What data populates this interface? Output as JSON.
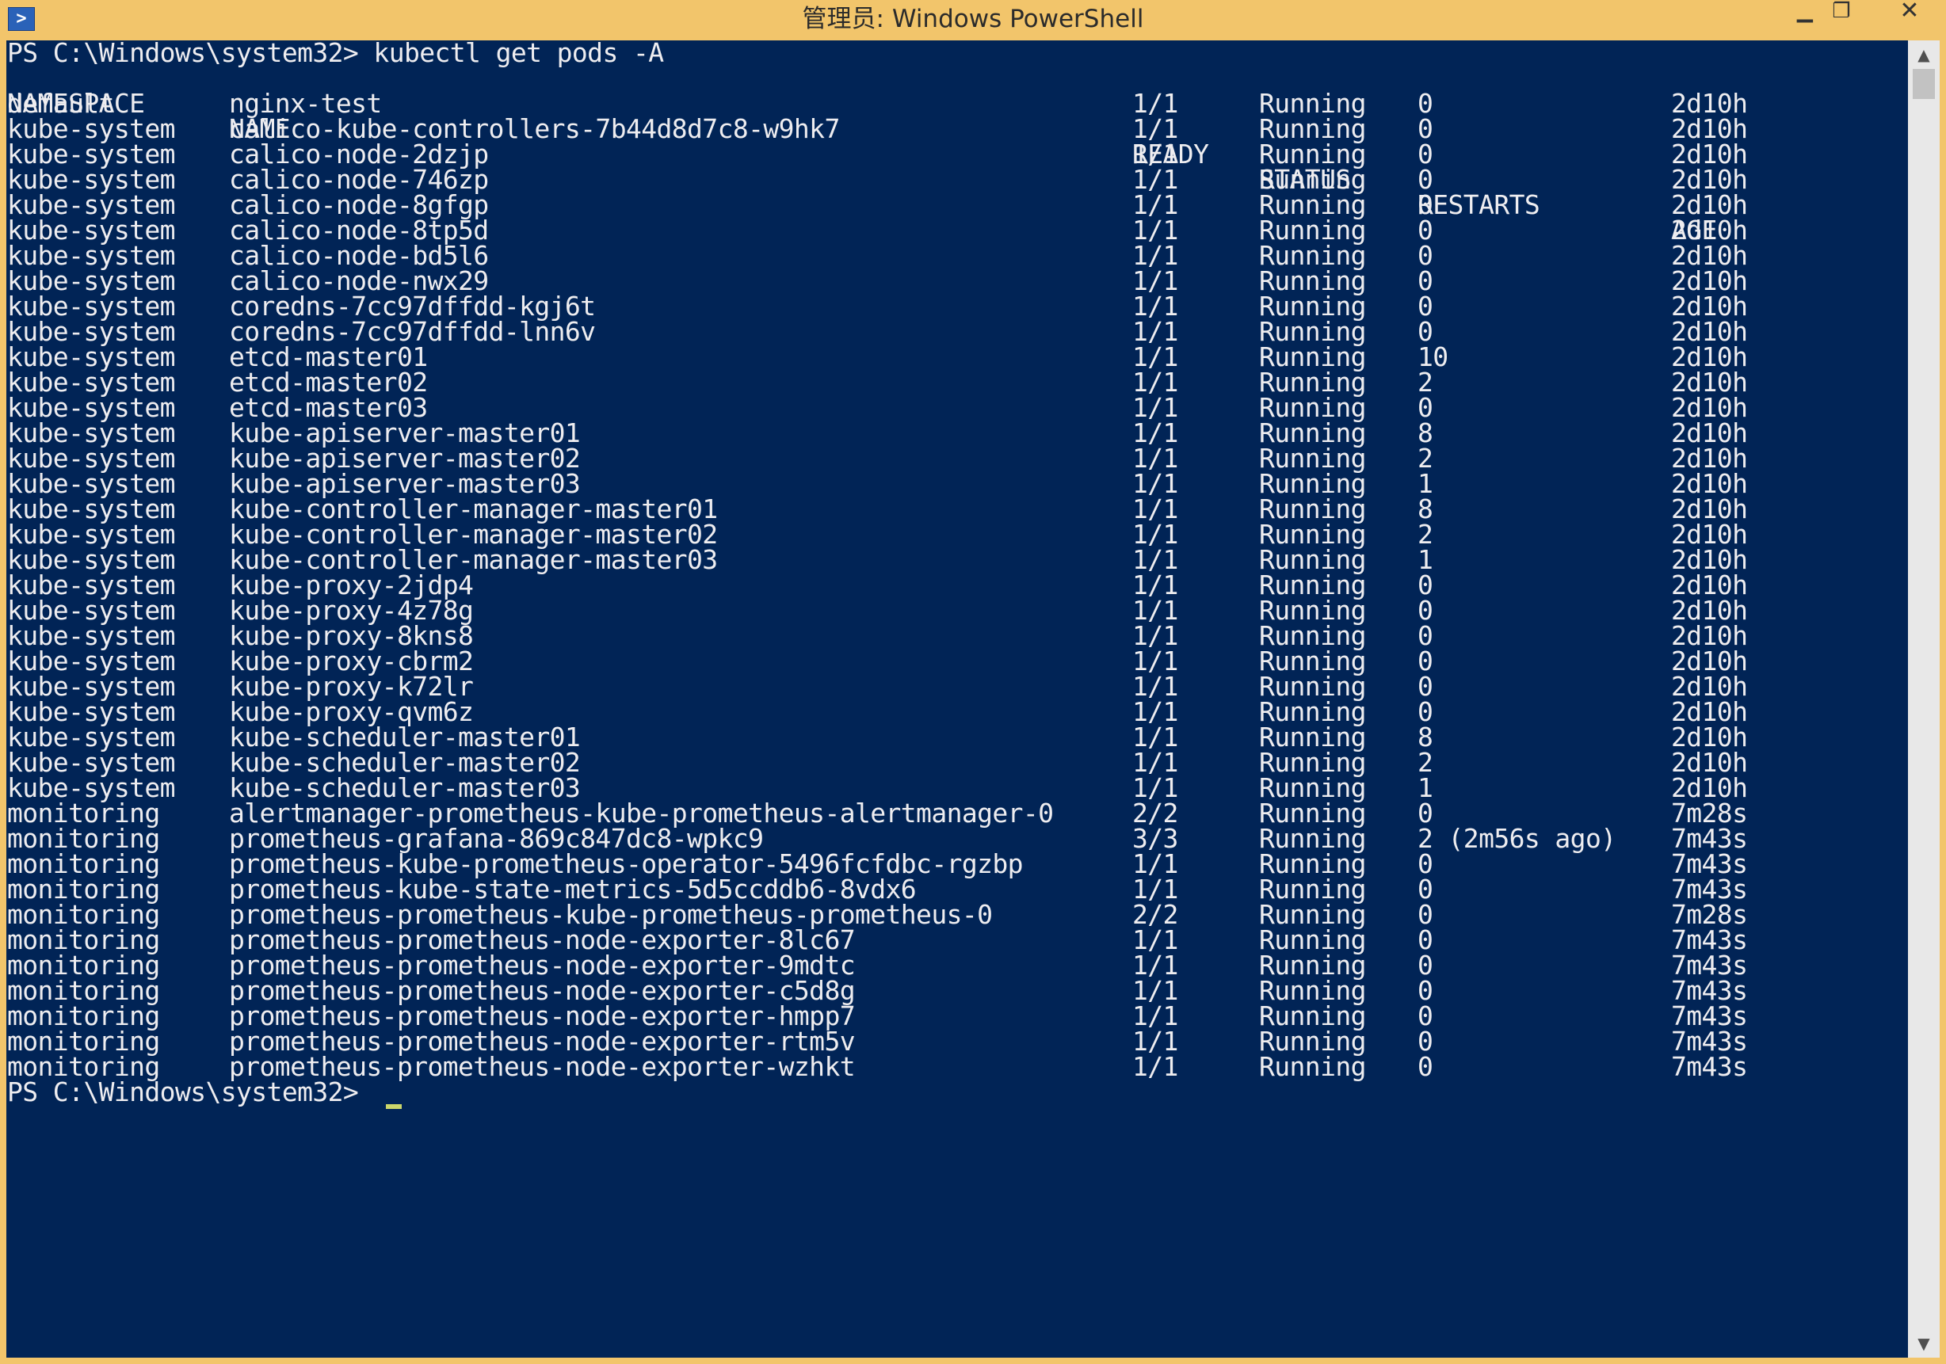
{
  "window": {
    "title": "管理员: Windows PowerShell",
    "icon": "powershell-icon",
    "controls": {
      "minimize": "▁",
      "maximize": "❐",
      "close": "✕"
    }
  },
  "console": {
    "prompt_command": "PS C:\\Windows\\system32> kubectl get pods -A",
    "prompt_end": "PS C:\\Windows\\system32> ",
    "headers": {
      "namespace": "NAMESPACE",
      "name": "NAME",
      "ready": "READY",
      "status": "STATUS",
      "restarts": "RESTARTS",
      "age": "AGE"
    },
    "rows": [
      {
        "ns": "default",
        "name": "nginx-test",
        "ready": "1/1",
        "status": "Running",
        "restarts": "0",
        "age": "2d10h"
      },
      {
        "ns": "kube-system",
        "name": "calico-kube-controllers-7b44d8d7c8-w9hk7",
        "ready": "1/1",
        "status": "Running",
        "restarts": "0",
        "age": "2d10h"
      },
      {
        "ns": "kube-system",
        "name": "calico-node-2dzjp",
        "ready": "1/1",
        "status": "Running",
        "restarts": "0",
        "age": "2d10h"
      },
      {
        "ns": "kube-system",
        "name": "calico-node-746zp",
        "ready": "1/1",
        "status": "Running",
        "restarts": "0",
        "age": "2d10h"
      },
      {
        "ns": "kube-system",
        "name": "calico-node-8gfgp",
        "ready": "1/1",
        "status": "Running",
        "restarts": "0",
        "age": "2d10h"
      },
      {
        "ns": "kube-system",
        "name": "calico-node-8tp5d",
        "ready": "1/1",
        "status": "Running",
        "restarts": "0",
        "age": "2d10h"
      },
      {
        "ns": "kube-system",
        "name": "calico-node-bd5l6",
        "ready": "1/1",
        "status": "Running",
        "restarts": "0",
        "age": "2d10h"
      },
      {
        "ns": "kube-system",
        "name": "calico-node-nwx29",
        "ready": "1/1",
        "status": "Running",
        "restarts": "0",
        "age": "2d10h"
      },
      {
        "ns": "kube-system",
        "name": "coredns-7cc97dffdd-kgj6t",
        "ready": "1/1",
        "status": "Running",
        "restarts": "0",
        "age": "2d10h"
      },
      {
        "ns": "kube-system",
        "name": "coredns-7cc97dffdd-lnn6v",
        "ready": "1/1",
        "status": "Running",
        "restarts": "0",
        "age": "2d10h"
      },
      {
        "ns": "kube-system",
        "name": "etcd-master01",
        "ready": "1/1",
        "status": "Running",
        "restarts": "10",
        "age": "2d10h"
      },
      {
        "ns": "kube-system",
        "name": "etcd-master02",
        "ready": "1/1",
        "status": "Running",
        "restarts": "2",
        "age": "2d10h"
      },
      {
        "ns": "kube-system",
        "name": "etcd-master03",
        "ready": "1/1",
        "status": "Running",
        "restarts": "0",
        "age": "2d10h"
      },
      {
        "ns": "kube-system",
        "name": "kube-apiserver-master01",
        "ready": "1/1",
        "status": "Running",
        "restarts": "8",
        "age": "2d10h"
      },
      {
        "ns": "kube-system",
        "name": "kube-apiserver-master02",
        "ready": "1/1",
        "status": "Running",
        "restarts": "2",
        "age": "2d10h"
      },
      {
        "ns": "kube-system",
        "name": "kube-apiserver-master03",
        "ready": "1/1",
        "status": "Running",
        "restarts": "1",
        "age": "2d10h"
      },
      {
        "ns": "kube-system",
        "name": "kube-controller-manager-master01",
        "ready": "1/1",
        "status": "Running",
        "restarts": "8",
        "age": "2d10h"
      },
      {
        "ns": "kube-system",
        "name": "kube-controller-manager-master02",
        "ready": "1/1",
        "status": "Running",
        "restarts": "2",
        "age": "2d10h"
      },
      {
        "ns": "kube-system",
        "name": "kube-controller-manager-master03",
        "ready": "1/1",
        "status": "Running",
        "restarts": "1",
        "age": "2d10h"
      },
      {
        "ns": "kube-system",
        "name": "kube-proxy-2jdp4",
        "ready": "1/1",
        "status": "Running",
        "restarts": "0",
        "age": "2d10h"
      },
      {
        "ns": "kube-system",
        "name": "kube-proxy-4z78g",
        "ready": "1/1",
        "status": "Running",
        "restarts": "0",
        "age": "2d10h"
      },
      {
        "ns": "kube-system",
        "name": "kube-proxy-8kns8",
        "ready": "1/1",
        "status": "Running",
        "restarts": "0",
        "age": "2d10h"
      },
      {
        "ns": "kube-system",
        "name": "kube-proxy-cbrm2",
        "ready": "1/1",
        "status": "Running",
        "restarts": "0",
        "age": "2d10h"
      },
      {
        "ns": "kube-system",
        "name": "kube-proxy-k72lr",
        "ready": "1/1",
        "status": "Running",
        "restarts": "0",
        "age": "2d10h"
      },
      {
        "ns": "kube-system",
        "name": "kube-proxy-qvm6z",
        "ready": "1/1",
        "status": "Running",
        "restarts": "0",
        "age": "2d10h"
      },
      {
        "ns": "kube-system",
        "name": "kube-scheduler-master01",
        "ready": "1/1",
        "status": "Running",
        "restarts": "8",
        "age": "2d10h"
      },
      {
        "ns": "kube-system",
        "name": "kube-scheduler-master02",
        "ready": "1/1",
        "status": "Running",
        "restarts": "2",
        "age": "2d10h"
      },
      {
        "ns": "kube-system",
        "name": "kube-scheduler-master03",
        "ready": "1/1",
        "status": "Running",
        "restarts": "1",
        "age": "2d10h"
      },
      {
        "ns": "monitoring",
        "name": "alertmanager-prometheus-kube-prometheus-alertmanager-0",
        "ready": "2/2",
        "status": "Running",
        "restarts": "0",
        "age": "7m28s"
      },
      {
        "ns": "monitoring",
        "name": "prometheus-grafana-869c847dc8-wpkc9",
        "ready": "3/3",
        "status": "Running",
        "restarts": "2 (2m56s ago)",
        "age": "7m43s"
      },
      {
        "ns": "monitoring",
        "name": "prometheus-kube-prometheus-operator-5496fcfdbc-rgzbp",
        "ready": "1/1",
        "status": "Running",
        "restarts": "0",
        "age": "7m43s"
      },
      {
        "ns": "monitoring",
        "name": "prometheus-kube-state-metrics-5d5ccddb6-8vdx6",
        "ready": "1/1",
        "status": "Running",
        "restarts": "0",
        "age": "7m43s"
      },
      {
        "ns": "monitoring",
        "name": "prometheus-prometheus-kube-prometheus-prometheus-0",
        "ready": "2/2",
        "status": "Running",
        "restarts": "0",
        "age": "7m28s"
      },
      {
        "ns": "monitoring",
        "name": "prometheus-prometheus-node-exporter-8lc67",
        "ready": "1/1",
        "status": "Running",
        "restarts": "0",
        "age": "7m43s"
      },
      {
        "ns": "monitoring",
        "name": "prometheus-prometheus-node-exporter-9mdtc",
        "ready": "1/1",
        "status": "Running",
        "restarts": "0",
        "age": "7m43s"
      },
      {
        "ns": "monitoring",
        "name": "prometheus-prometheus-node-exporter-c5d8g",
        "ready": "1/1",
        "status": "Running",
        "restarts": "0",
        "age": "7m43s"
      },
      {
        "ns": "monitoring",
        "name": "prometheus-prometheus-node-exporter-hmpp7",
        "ready": "1/1",
        "status": "Running",
        "restarts": "0",
        "age": "7m43s"
      },
      {
        "ns": "monitoring",
        "name": "prometheus-prometheus-node-exporter-rtm5v",
        "ready": "1/1",
        "status": "Running",
        "restarts": "0",
        "age": "7m43s"
      },
      {
        "ns": "monitoring",
        "name": "prometheus-prometheus-node-exporter-wzhkt",
        "ready": "1/1",
        "status": "Running",
        "restarts": "0",
        "age": "7m43s"
      }
    ]
  },
  "colors": {
    "titlebar": "#f2c56b",
    "console_bg": "#012456",
    "console_text": "#eeedf0",
    "cursor": "#cbd66b"
  },
  "scrollbar": {
    "up_arrow": "▲",
    "down_arrow": "▼"
  }
}
